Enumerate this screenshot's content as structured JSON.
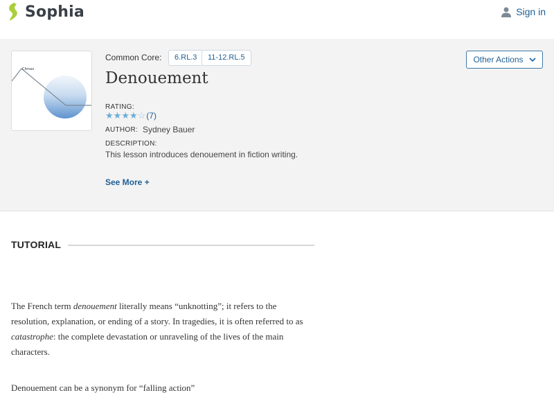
{
  "header": {
    "logo_text": "Sophia",
    "signin_label": "Sign in",
    "brand_color": "#a9cf3b",
    "link_color": "#1f5f95"
  },
  "lesson": {
    "thumbnail_caption": "Climax",
    "common_core_label": "Common Core:",
    "standards": [
      "6.RL.3",
      "11-12.RL.5"
    ],
    "title": "Denouement",
    "rating_label": "RATING:",
    "rating_value": 4,
    "rating_max": 5,
    "rating_count": "(7)",
    "author_label": "AUTHOR:",
    "author_name": "Sydney Bauer",
    "description_label": "DESCRIPTION:",
    "description": "This lesson introduces denouement in fiction writing.",
    "see_more": "See More +",
    "other_actions": "Other Actions"
  },
  "tutorial": {
    "heading": "TUTORIAL",
    "p1_a": "The French term ",
    "p1_term": "denouement",
    "p1_b": " literally means “unknotting”; it refers to the resolution, explanation, or ending of a story. In tragedies, it is often referred to as ",
    "p1_term2": "catastrophe",
    "p1_c": ": the complete devastation or unraveling of the lives of the main characters.",
    "p2": "Denouement can be a synonym for “falling action”"
  }
}
